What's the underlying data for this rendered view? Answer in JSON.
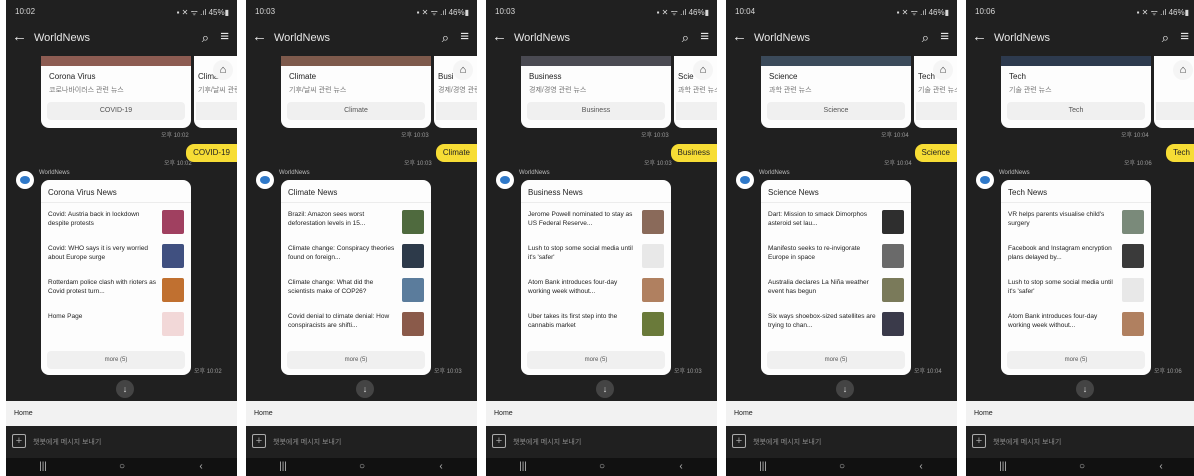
{
  "app_title": "WorldNews",
  "status_icons": "▪️ ✕ ᯤ .ıl 46%▮",
  "home_label": "Home",
  "input_placeholder": "챗봇에게 메시지 보내기",
  "more_label": "more (5)",
  "sender_name": "WorldNews",
  "phones": [
    {
      "time": "10:02",
      "status_right": "▪ ✕ ᯤ .ıl 45%▮",
      "top_card": {
        "title": "Corona Virus",
        "subtitle": "코로나바이러스 관련 뉴스",
        "button": "COVID-19",
        "image_color": "#8d5c52"
      },
      "peek_card": {
        "title": "Climate",
        "subtitle": "기후/날씨 관련"
      },
      "top_time": "오후 10:02",
      "bubble_time": "오후 10:02",
      "bubble": "COVID-19",
      "news": {
        "header": "Corona Virus News",
        "items": [
          {
            "text": "Covid: Austria back in lockdown despite protests",
            "thumb": "#a04060"
          },
          {
            "text": "Covid: WHO says it is very worried about Europe surge",
            "thumb": "#405080"
          },
          {
            "text": "Rotterdam police clash with rioters as Covid protest turn...",
            "thumb": "#c07030"
          },
          {
            "text": "Home Page",
            "thumb": "#f2d8d8"
          }
        ]
      },
      "card_time": "오후 10:02"
    },
    {
      "time": "10:03",
      "status_right": "▪ ✕ ᯤ .ıl 46%▮",
      "top_card": {
        "title": "Climate",
        "subtitle": "기후/날씨 관련 뉴스",
        "button": "Climate",
        "image_color": "#7e5a4c"
      },
      "peek_card": {
        "title": "Busi",
        "subtitle": "경제/경영 관련"
      },
      "top_time": "오후 10:03",
      "bubble_time": "오후 10:03",
      "bubble": "Climate",
      "news": {
        "header": "Climate News",
        "items": [
          {
            "text": "Brazil: Amazon sees worst deforestation levels in 15...",
            "thumb": "#4f6a3e"
          },
          {
            "text": "Climate change: Conspiracy theories found on foreign...",
            "thumb": "#2d3a4a"
          },
          {
            "text": "Climate change: What did the scientists make of COP26?",
            "thumb": "#5b7c9c"
          },
          {
            "text": "Covid denial to climate denial: How conspiracists are shifti...",
            "thumb": "#8a5a4a"
          }
        ]
      },
      "card_time": "오후 10:03"
    },
    {
      "time": "10:03",
      "status_right": "▪ ✕ ᯤ .ıl 46%▮",
      "top_card": {
        "title": "Business",
        "subtitle": "경제/경영 관련 뉴스",
        "button": "Business",
        "image_color": "#4a4a52"
      },
      "peek_card": {
        "title": "Scie",
        "subtitle": "과학 관련 뉴스"
      },
      "top_time": "오후 10:03",
      "bubble_time": "오후 10:03",
      "bubble": "Business",
      "news": {
        "header": "Business News",
        "items": [
          {
            "text": "Jerome Powell nominated to stay as US Federal Reserve...",
            "thumb": "#8a6a5a"
          },
          {
            "text": "Lush to stop some social media until it's 'safer'",
            "thumb": "#e8e8e8"
          },
          {
            "text": "Atom Bank introduces four-day working week without...",
            "thumb": "#b08060"
          },
          {
            "text": "Uber takes its first step into the cannabis market",
            "thumb": "#6a7a3a"
          }
        ]
      },
      "card_time": "오후 10:03"
    },
    {
      "time": "10:04",
      "status_right": "▪ ✕ ᯤ .ıl 46%▮",
      "top_card": {
        "title": "Science",
        "subtitle": "과학 관련 뉴스",
        "button": "Science",
        "image_color": "#3b4a5a"
      },
      "peek_card": {
        "title": "Tech",
        "subtitle": "기술 관련 뉴스"
      },
      "top_time": "오후 10:04",
      "bubble_time": "오후 10:04",
      "bubble": "Science",
      "news": {
        "header": "Science News",
        "items": [
          {
            "text": "Dart: Mission to smack Dimorphos asteroid set lau...",
            "thumb": "#2e2e2e"
          },
          {
            "text": "Manifesto seeks to re-invigorate Europe in space",
            "thumb": "#6a6a6a"
          },
          {
            "text": "Australia declares La Niña weather event has begun",
            "thumb": "#7a7a5a"
          },
          {
            "text": "Six ways shoebox-sized satellites are trying to chan...",
            "thumb": "#3a3a4a"
          }
        ]
      },
      "card_time": "오후 10:04"
    },
    {
      "time": "10:06",
      "status_right": "▪ ✕ ᯤ .ıl 46%▮",
      "top_card": {
        "title": "Tech",
        "subtitle": "기술 관련 뉴스",
        "button": "Tech",
        "image_color": "#2d3a4e"
      },
      "peek_card": {
        "title": "",
        "subtitle": ""
      },
      "top_time": "오후 10:04",
      "bubble_time": "오후 10:06",
      "bubble": "Tech",
      "news": {
        "header": "Tech News",
        "items": [
          {
            "text": "VR helps parents visualise child's surgery",
            "thumb": "#7a8a7a"
          },
          {
            "text": "Facebook and Instagram encryption plans delayed by...",
            "thumb": "#3a3a3a"
          },
          {
            "text": "Lush to stop some social media until it's 'safer'",
            "thumb": "#e8e8e8"
          },
          {
            "text": "Atom Bank introduces four-day working week without...",
            "thumb": "#b08060"
          }
        ]
      },
      "card_time": "오후 10:06"
    }
  ]
}
